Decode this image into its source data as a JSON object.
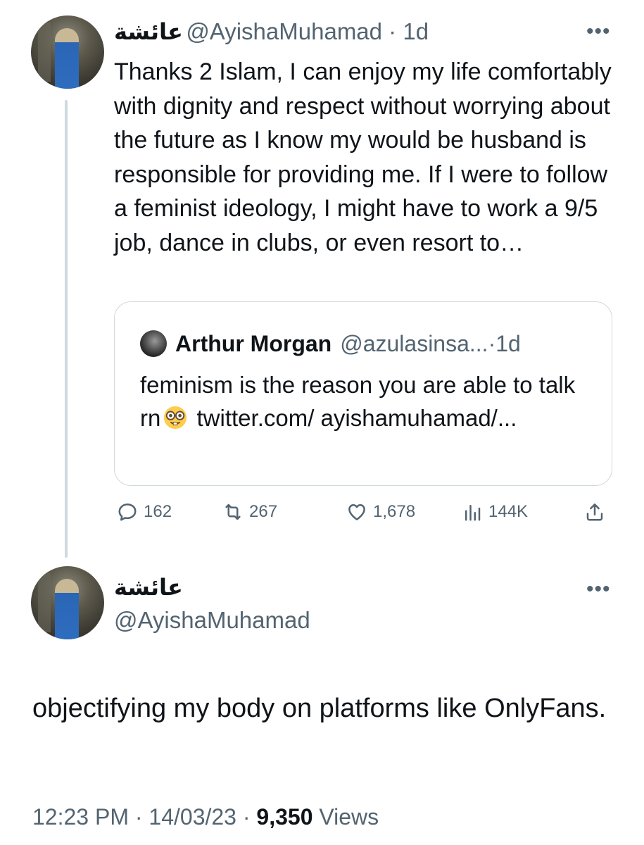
{
  "parent_tweet": {
    "display_name": "عائشة",
    "handle": "@AyishaMuhamad",
    "time": "1d",
    "separator": " · ",
    "text": "Thanks 2 Islam, I can enjoy my life comfortably with dignity and respect without worrying about the future as I know my would be husband is responsible for providing me. If I were to follow a feminist ideology, I might have to work a 9/5 job, dance in clubs, or even resort to…",
    "more_label": "•••",
    "quote": {
      "name": "Arthur Morgan",
      "handle": "@azulasinsa...",
      "time": "1d",
      "separator": " · ",
      "text_before_emoji": "feminism is the reason you are able to talk rn",
      "emoji": "nerd-face",
      "text_after_emoji": " twitter.com/ ayishamuhamad/..."
    },
    "actions": {
      "replies": "162",
      "retweets": "267",
      "likes": "1,678",
      "views": "144K"
    }
  },
  "main_tweet": {
    "display_name": "عائشة",
    "handle": "@AyishaMuhamad",
    "more_label": "•••",
    "text": "objectifying my body on platforms like OnlyFans.",
    "time": "12:23 PM",
    "date": "14/03/23",
    "separator": " · ",
    "views_count": "9,350",
    "views_label": "Views"
  },
  "colors": {
    "text": "#0f1419",
    "secondary": "#536471",
    "border": "#cfd9de"
  }
}
